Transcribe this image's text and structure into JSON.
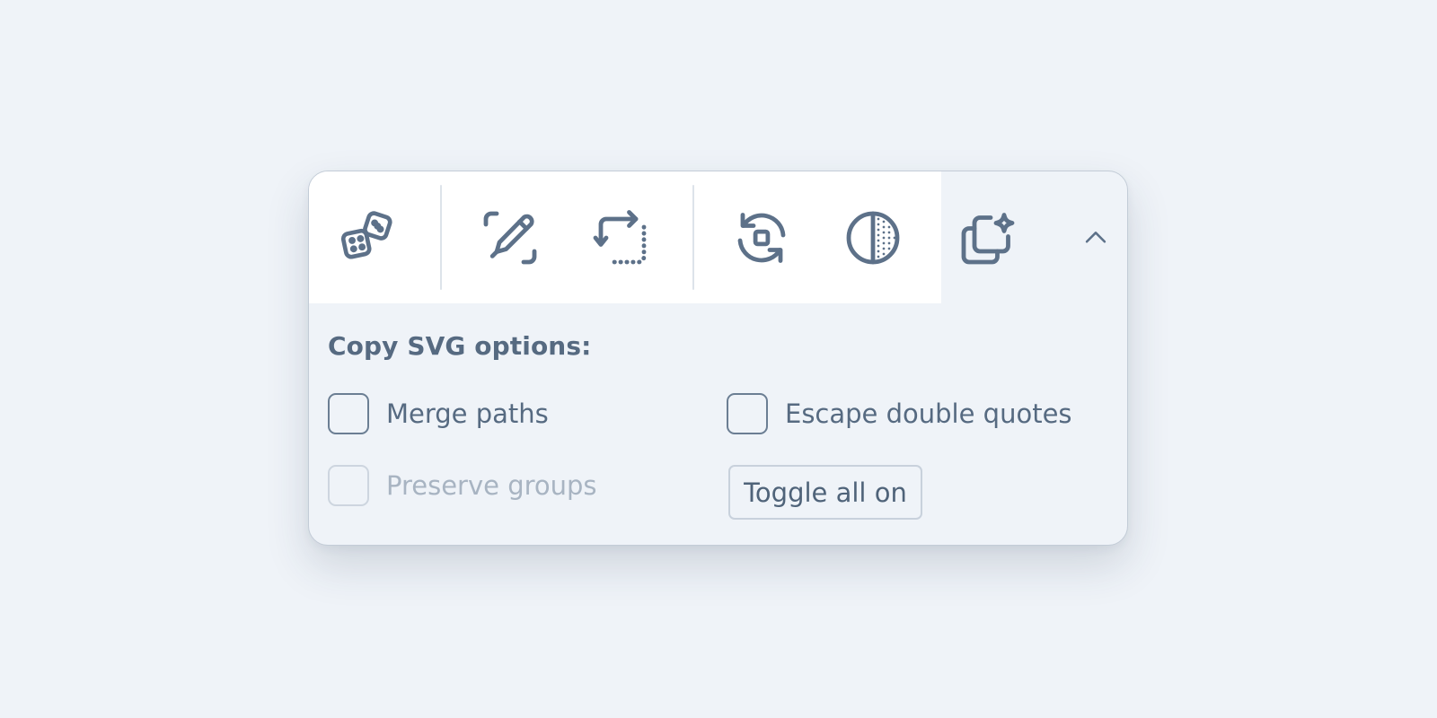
{
  "toolbar": {
    "tools": [
      {
        "name": "randomize",
        "icon": "dice-icon"
      },
      {
        "name": "draw",
        "icon": "pen-in-frame-icon"
      },
      {
        "name": "transform",
        "icon": "repeat-arrows-icon"
      },
      {
        "name": "refresh",
        "icon": "refresh-square-icon"
      },
      {
        "name": "contrast",
        "icon": "contrast-dots-icon"
      }
    ],
    "copy_icon": "copy-sparkle-icon",
    "collapse_icon": "chevron-up-icon"
  },
  "options": {
    "title": "Copy SVG options:",
    "merge_paths": {
      "label": "Merge paths",
      "checked": false,
      "disabled": false
    },
    "escape_quotes": {
      "label": "Escape double quotes",
      "checked": false,
      "disabled": false
    },
    "preserve_groups": {
      "label": "Preserve groups",
      "checked": false,
      "disabled": true
    },
    "toggle_all_label": "Toggle all on"
  },
  "colors": {
    "background": "#eff3f8",
    "toolbar": "#ffffff",
    "icon": "#5d7189",
    "text": "#566a81",
    "disabled_text": "#a8b4c2",
    "border": "#c3ccd7"
  }
}
